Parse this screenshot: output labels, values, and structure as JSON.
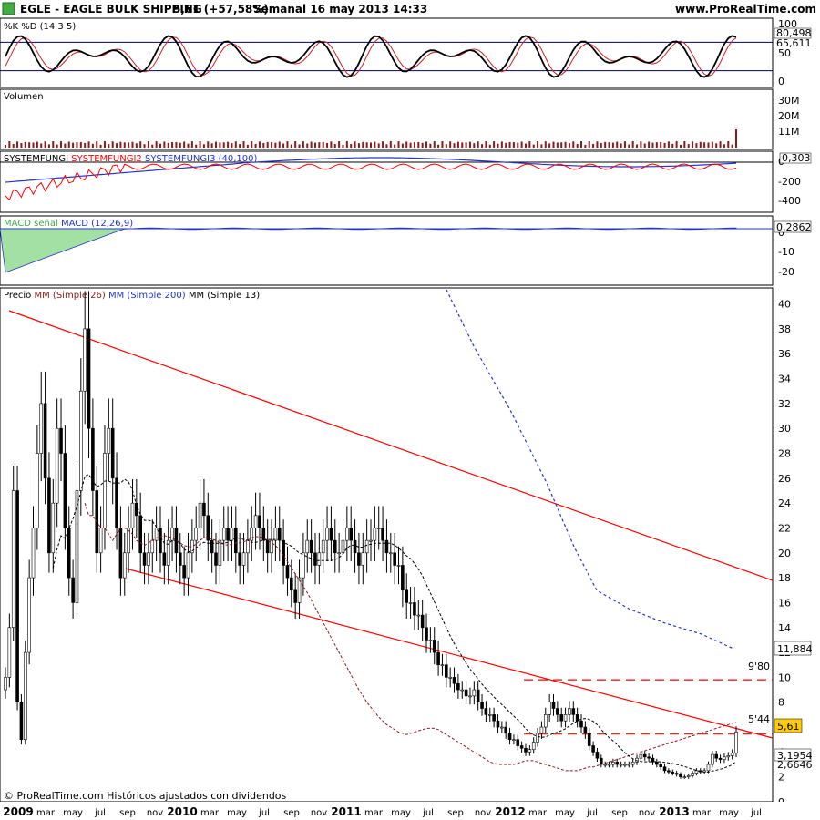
{
  "header": {
    "ticker": "EGLE - EAGLE BULK SHIPPING",
    "quote": "5,61 (+57,58%)",
    "period": "Semanal  16 may 2013 14:33",
    "site": "www.ProRealTime.com"
  },
  "footer": "© ProRealTime.com Históricos ajustados con dividendos",
  "colors": {
    "price_up": "#ffffff",
    "price_down": "#000000",
    "sma26": "#8b1a1a",
    "sma200": "#2233cc",
    "sma13": "#000000",
    "trendline": "#ff0000",
    "stoch_k": "#000000",
    "stoch_d": "#cc2222",
    "volume": "#8b1a1a",
    "macd_hist": "#66cc66",
    "last_price_bg": "#ffcc00"
  },
  "chart_data": [
    {
      "type": "line",
      "panel": "stochastic",
      "title": "%K %D (14 3 5)",
      "series_names": [
        "%K",
        "%D"
      ],
      "levels": [
        80,
        20
      ],
      "y_ticks": [
        "100",
        "50",
        "0"
      ],
      "last_values": [
        "80,498",
        "65,611"
      ]
    },
    {
      "type": "bar",
      "panel": "volume",
      "title": "Volumen",
      "y_ticks": [
        "30M",
        "20M",
        "11M"
      ]
    },
    {
      "type": "line",
      "panel": "systemfungi",
      "title_parts": [
        "SYSTEMFUNGI",
        "SYSTEMFUNGI2",
        "SYSTEMFUNGI3 (40,100)"
      ],
      "y_ticks": [
        "0",
        "-200",
        "-400"
      ],
      "last_value": "0,303"
    },
    {
      "type": "area",
      "panel": "macd",
      "title_parts": [
        "MACD",
        "señal",
        "MACD (12,26,9)"
      ],
      "y_ticks": [
        "0",
        "-10",
        "-20"
      ],
      "last_value": "0,2862"
    },
    {
      "type": "candlestick",
      "panel": "price",
      "title_parts": [
        "Precio",
        "MM (Simple 26)",
        "MM (Simple 200)",
        "MM (Simple 13)"
      ],
      "y_ticks": [
        40,
        38,
        36,
        34,
        32,
        30,
        28,
        26,
        24,
        22,
        20,
        18,
        16,
        14,
        12,
        10,
        8,
        6,
        4,
        2,
        0
      ],
      "ylim": [
        0,
        40
      ],
      "last_price": "5,61",
      "sma200_last": "11,884",
      "sma13_last": "3,1954",
      "sma26_last": "2,6646",
      "resistance_levels": [
        {
          "value": 9.8,
          "label": "9'80"
        },
        {
          "value": 5.44,
          "label": "5'44"
        }
      ],
      "x_labels": [
        {
          "text": "2009",
          "year": true
        },
        {
          "text": "mar"
        },
        {
          "text": "may"
        },
        {
          "text": "jul"
        },
        {
          "text": "sep"
        },
        {
          "text": "nov"
        },
        {
          "text": "2010",
          "year": true
        },
        {
          "text": "mar"
        },
        {
          "text": "may"
        },
        {
          "text": "jul"
        },
        {
          "text": "sep"
        },
        {
          "text": "nov"
        },
        {
          "text": "2011",
          "year": true
        },
        {
          "text": "mar"
        },
        {
          "text": "may"
        },
        {
          "text": "jul"
        },
        {
          "text": "sep"
        },
        {
          "text": "nov"
        },
        {
          "text": "2012",
          "year": true
        },
        {
          "text": "mar"
        },
        {
          "text": "may"
        },
        {
          "text": "jul"
        },
        {
          "text": "sep"
        },
        {
          "text": "nov"
        },
        {
          "text": "2013",
          "year": true
        },
        {
          "text": "mar"
        },
        {
          "text": "may"
        },
        {
          "text": "jul"
        }
      ],
      "closes": [
        10,
        14,
        25,
        8,
        5,
        12,
        18,
        22,
        28,
        32,
        26,
        20,
        24,
        30,
        28,
        22,
        18,
        16,
        25,
        33,
        38,
        30,
        25,
        20,
        22,
        28,
        30,
        26,
        22,
        18,
        20,
        22,
        24,
        23,
        20,
        19,
        20,
        21,
        22,
        20,
        19,
        21,
        22,
        20,
        19,
        18,
        20,
        21,
        22,
        24,
        23,
        21,
        20,
        19,
        21,
        22,
        21,
        22,
        20,
        19,
        20,
        21,
        22,
        23,
        22,
        21,
        20,
        21,
        22,
        21,
        19,
        18,
        17,
        16,
        18,
        20,
        21,
        20,
        19,
        20,
        21,
        22,
        21,
        20,
        20,
        21,
        22,
        21,
        20,
        19,
        20,
        21,
        21,
        22,
        22,
        21,
        20,
        20,
        19,
        19,
        17,
        16,
        16,
        15,
        15,
        14,
        13,
        13,
        12,
        11,
        11,
        10,
        10,
        9.5,
        9,
        9,
        8.5,
        8.5,
        9,
        8,
        7.5,
        7,
        7,
        6.5,
        6,
        6,
        5.5,
        5,
        5,
        4.5,
        4.3,
        4,
        4.2,
        4.8,
        5.5,
        6,
        7,
        8,
        7.5,
        7,
        6.5,
        7,
        7.5,
        7,
        6.5,
        6,
        5.5,
        4.5,
        4,
        3.5,
        3,
        3,
        3,
        3.2,
        3,
        3,
        3,
        3,
        3.2,
        3.5,
        3.8,
        3.6,
        3.5,
        3.2,
        3,
        2.8,
        2.5,
        2.4,
        2.3,
        2.2,
        2,
        2,
        2.1,
        2.3,
        2.5,
        2.4,
        2.5,
        3,
        3.8,
        3.5,
        3.4,
        3.6,
        3.7,
        3.9,
        5.61
      ],
      "sma26": [
        null,
        null,
        null,
        null,
        null,
        null,
        null,
        null,
        null,
        null,
        null,
        null,
        null,
        null,
        null,
        null,
        null,
        null,
        null,
        null,
        24,
        23,
        23,
        22.5,
        22,
        22,
        21.5,
        21,
        21.5,
        22,
        22,
        21.8,
        21.5,
        21,
        20.8,
        20.6,
        20.8,
        21,
        21.2,
        21.3,
        21.4,
        21.3,
        21.2,
        21,
        20.8,
        20.6,
        20.5,
        20.5,
        20.7,
        21,
        21.2,
        21.2,
        21.1,
        21,
        20.8,
        20.7,
        20.6,
        20.7,
        20.8,
        20.8,
        20.9,
        21,
        21.2,
        21.3,
        21.3,
        21.2,
        21,
        20.8,
        20.6,
        20.2,
        19.8,
        19.3,
        18.8,
        18.3,
        17.8,
        17.3,
        16.8,
        16.2,
        15.6,
        15,
        14.4,
        13.8,
        13.2,
        12.6,
        12,
        11.4,
        10.8,
        10.2,
        9.6,
        9,
        8.5,
        8,
        7.6,
        7.2,
        6.8,
        6.5,
        6.2,
        6,
        5.8,
        5.6,
        5.5,
        5.4,
        5.5,
        5.6,
        5.7,
        5.8,
        5.9,
        5.9,
        5.9,
        5.8,
        5.6,
        5.4,
        5.2,
        5,
        4.8,
        4.6,
        4.4,
        4.2,
        4,
        3.8,
        3.6,
        3.4,
        3.2,
        3.1,
        3,
        3,
        3,
        3,
        3,
        3.1,
        3.2,
        3.3,
        3.3,
        3.3,
        3.2,
        3.1,
        3,
        2.9,
        2.8,
        2.7,
        2.6,
        2.5,
        2.5,
        2.5,
        2.5,
        2.6,
        2.7,
        2.8,
        2.8,
        2.9,
        3,
        3.1,
        3.2,
        3.3,
        3.4,
        3.5,
        3.6,
        3.7,
        3.8,
        3.9,
        4,
        4.1,
        4.2,
        4.3,
        4.4,
        4.5,
        4.6,
        4.7,
        4.8,
        4.9,
        5,
        5.1,
        5.2,
        5.3,
        5.4,
        5.5,
        5.6,
        5.7,
        5.8,
        5.9,
        6,
        6.1,
        6.2,
        6.3,
        6.4,
        6.5,
        6.6,
        6.7,
        6.8,
        6.9,
        7,
        7.1,
        7.2,
        7.3,
        7.4,
        7.5,
        7.6,
        7.7,
        7.8,
        7.9,
        8,
        8.1,
        8.2,
        8.3,
        8.4,
        8.5,
        8.6
      ]
    }
  ]
}
